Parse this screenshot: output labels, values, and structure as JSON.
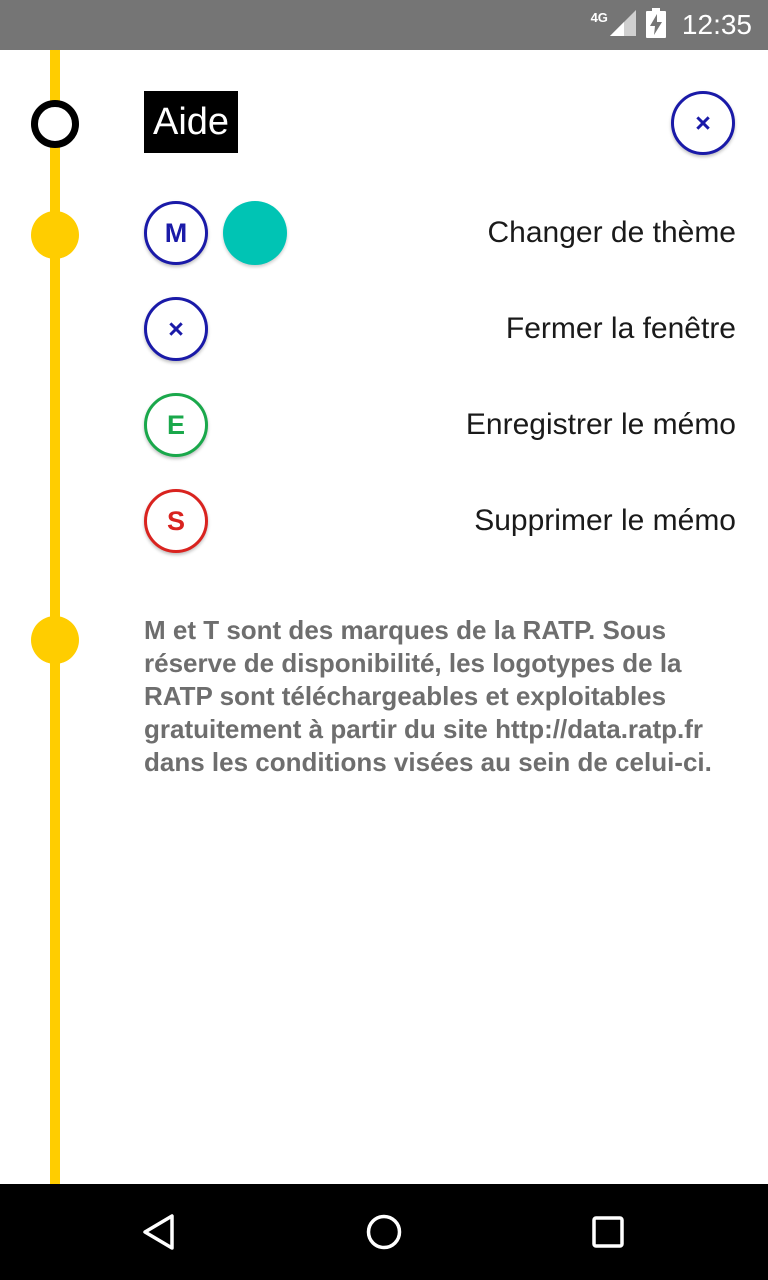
{
  "status_bar": {
    "network": "4G",
    "time": "12:35"
  },
  "header": {
    "title": "Aide",
    "close_symbol": "×"
  },
  "rows": [
    {
      "symbol": "M",
      "label": "Changer de thème",
      "color": "#1a1aa8"
    },
    {
      "symbol": "×",
      "label": "Fermer la fenêtre",
      "color": "#1a1aa8"
    },
    {
      "symbol": "E",
      "label": "Enregistrer le mémo",
      "color": "#1aa84b"
    },
    {
      "symbol": "S",
      "label": "Supprimer le mémo",
      "color": "#d9231f"
    }
  ],
  "theme_swatch_color": "#00c4b4",
  "line_color": "#ffcd00",
  "legal_text": "M et T sont des marques de la RATP. Sous réserve de disponibilité, les logotypes de la RATP sont téléchargeables et exploitables gratuitement à partir du site http://data.ratp.fr dans les conditions visées au sein de celui-ci.",
  "icons": {
    "signal": "signal-icon",
    "battery": "battery-charging-icon",
    "back": "back-triangle-icon",
    "home": "home-circle-icon",
    "recent": "recent-apps-square-icon"
  }
}
